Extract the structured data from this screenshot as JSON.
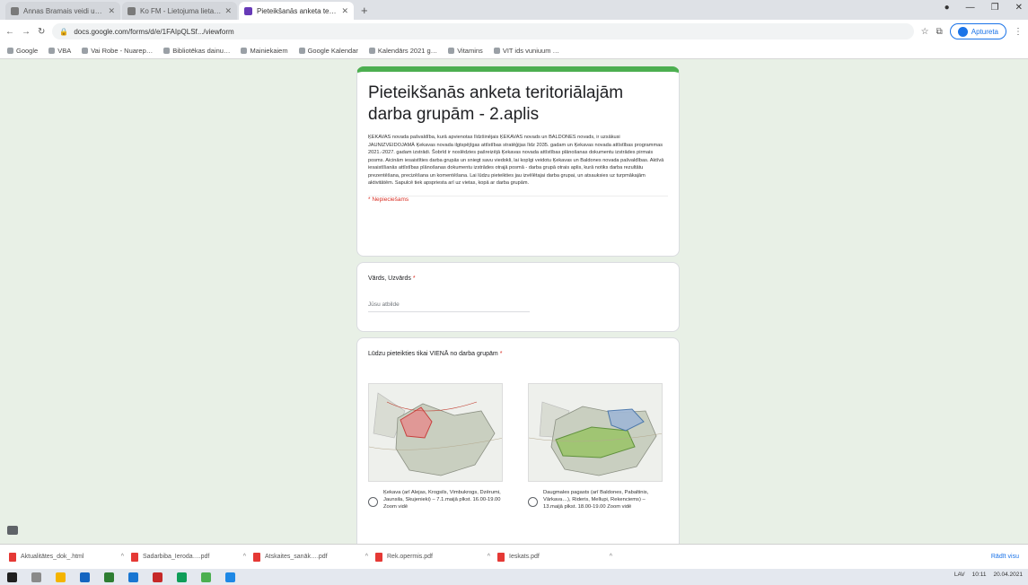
{
  "browser": {
    "tabs": [
      {
        "title": "Annas Bramais veidi un Curs…",
        "active": false
      },
      {
        "title": "Ko FM - Lietojuma lieta m…",
        "active": false
      },
      {
        "title": "Pieteikšanās anketa teritoriālaj…",
        "active": true
      }
    ],
    "new_tab": "+",
    "url": "docs.google.com/forms/d/e/1FAIpQLSf.../viewform",
    "profile_label": "Aptureta",
    "bookmarks": [
      "Google",
      "VBA",
      "Vai Robe - Nuarep…",
      "Bibliotēkas dainu…",
      "Mainiekaiem",
      "Google Kalendar",
      "Kalendārs 2021 g…",
      "Vitamins",
      "VIT ids vuniuum …"
    ]
  },
  "form": {
    "title": "Pieteikšanās anketa teritoriālajām darba grupām - 2.aplis",
    "description": "ĶEKAVAS novada pašvaldība, kurā apvienotas līdzšinējais ĶEKAVAS novads un BALDONES novads, ir uzsākusi JAUNIZVEIDOJAMĀ Ķekavas novada ilgtspējīgas attīstības stratēģijas līdz 2035. gadam un Ķekavas novada attīstības programmas 2021.-2027. gadam izstrādi. Šobrīd ir noslēdzies pašreizējā Ķekavas novada attīstības plānošanas dokumentu izstrādes pirmais posms. Aicinām iesaistīties darba grupās un sniegt savu viedokli, lai kopīgi veidotu Ķekavas un Baldones novada pašvaldības. Aktīvā iesaistīšanās attīstības plānošanas dokumentu izstrādes otrajā posmā - darba grupā otrais aplis, kurā notiks darba rezultātu prezentēšana, precizēšana un komentēšana. Lai lūdzu pieteikties jau izvēlētajai darba grupai, un atsauksies uz turpmākajām aktivitātēm. Sapulcē tiek apspriesta arī uz vietas, kopā ar darba grupām.",
    "required_note": "* Nepieciešams",
    "q1": {
      "label": "Vārds, Uzvārds",
      "required_mark": "*",
      "placeholder": "Jūsu atbilde"
    },
    "q2": {
      "label": "Lūdzu pieteikties tikai VIENĀ no darba grupām",
      "required_mark": "*",
      "options": [
        {
          "text": "Ķekava (arī Alejas, Krogsils, Vimbukrogs, Dzērumi, Jaunsila, Skujenieki) – 7.1.maijā plkst. 16.00-19.00 Zoom vidē"
        },
        {
          "text": "Daugmales pagasts (arī Baldones, Pabaltinis, Vārkava…), Rideris, Mellupi, Rekenciems) – 13.maijā plkst. 18.00-19.00 Zoom vidē"
        }
      ]
    }
  },
  "downloads": [
    "Aktualitātes_dok_.html",
    "Sadarbiba_Ieroda….pdf",
    "Atskaites_sanāk….pdf",
    "Rek.opermis.pdf",
    "Ieskats.pdf"
  ],
  "show_all": "Rādīt visu",
  "tray": {
    "lang": "LAV",
    "time": "10:11",
    "date": "20.04.2021"
  }
}
